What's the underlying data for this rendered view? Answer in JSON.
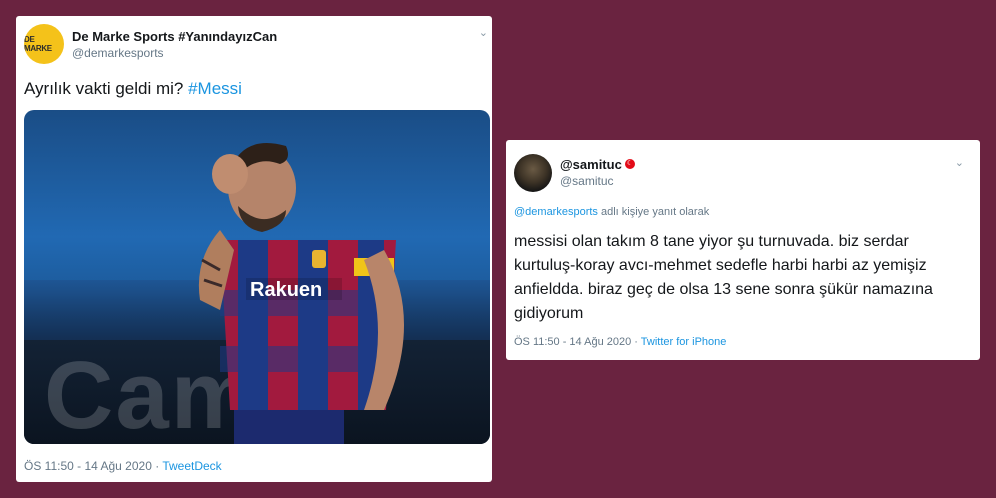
{
  "tweet_left": {
    "avatar_text": "DE MARKE",
    "display_name": "De Marke Sports #YanındayızCan",
    "handle": "@demarkesports",
    "text": "Ayrılık vakti geldi mi? ",
    "hashtag": "#Messi",
    "photo_sign_text": "Cam",
    "timestamp": "ÖS 11:50 - 14 Ağu 2020 · ",
    "source": "TweetDeck"
  },
  "tweet_right": {
    "display_name": "@samituc",
    "handle": "@samituc",
    "reply_mention": "@demarkesports",
    "reply_suffix": " adlı kişiye yanıt olarak",
    "text": "messisi olan takım 8 tane yiyor şu turnuvada. biz serdar kurtuluş-koray avcı-mehmet sedefle harbi harbi az yemişiz anfieldda. biraz geç de olsa 13 sene sonra şükür namazına gidiyorum",
    "timestamp": "ÖS 11:50 - 14 Ağu 2020 · ",
    "source": "Twitter for iPhone"
  },
  "icons": {
    "chevron": "⌄",
    "flag_symbol": "☾"
  },
  "colors": {
    "background": "#6a2340",
    "link": "#1b95e0",
    "avatar_left": "#f4c21a"
  }
}
